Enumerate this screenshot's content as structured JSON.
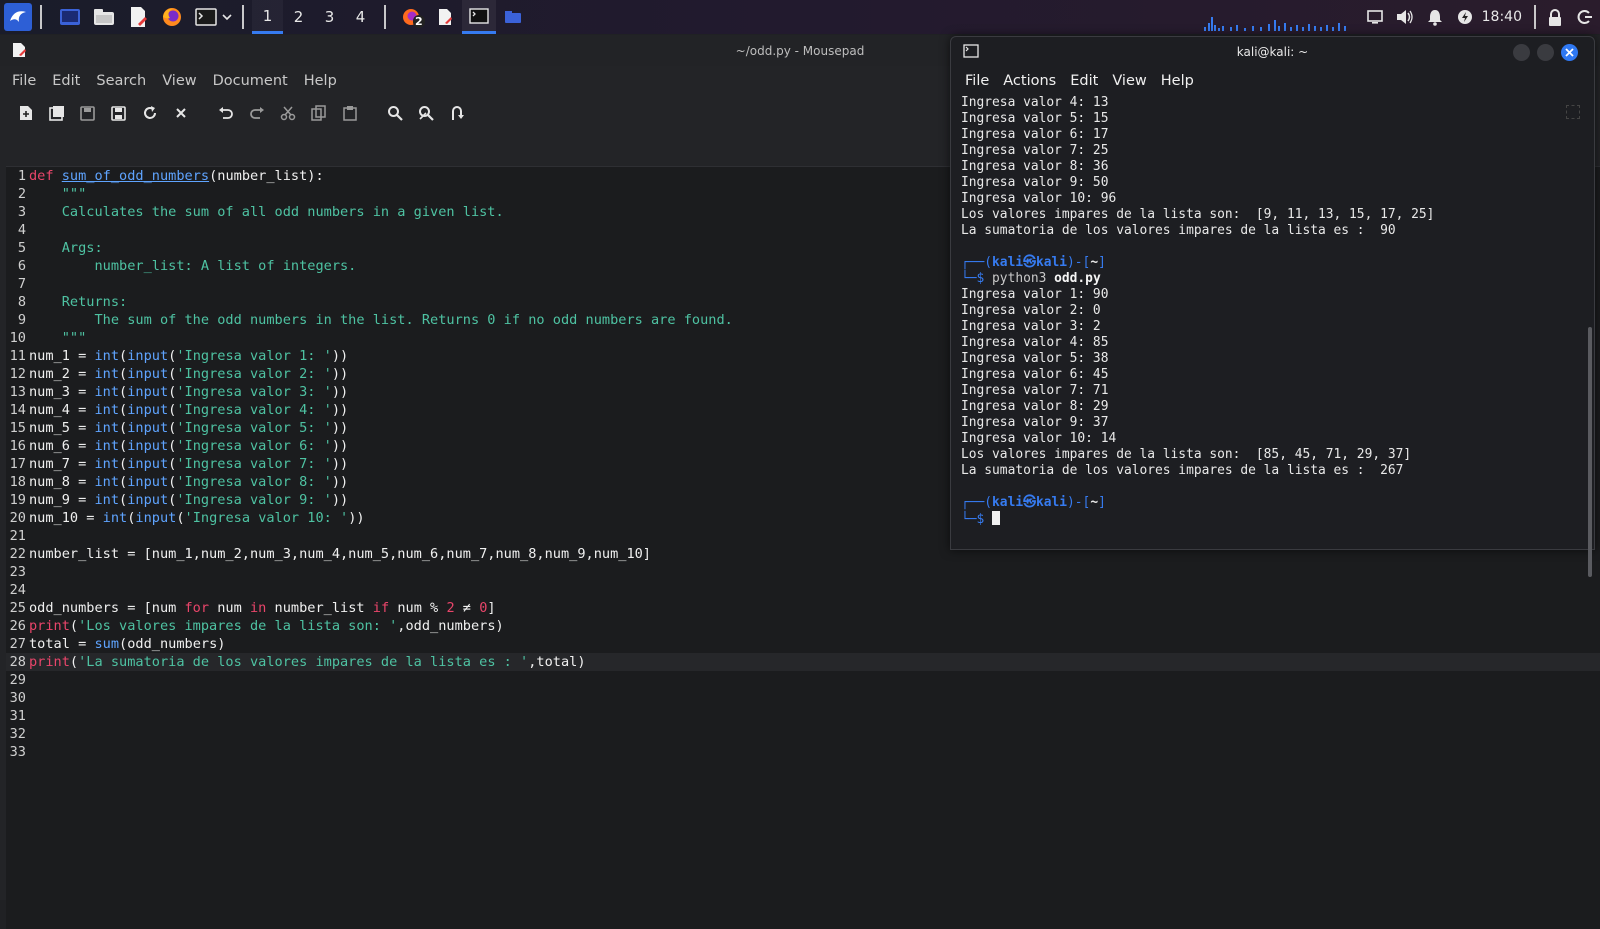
{
  "taskbar": {
    "workspaces": [
      "1",
      "2",
      "3",
      "4"
    ],
    "badge_count": "2",
    "clock": "18:40",
    "accent": "#367bf0"
  },
  "mousepad": {
    "title": "~/odd.py - Mousepad",
    "menu": [
      "File",
      "Edit",
      "Search",
      "View",
      "Document",
      "Help"
    ],
    "toolbar": [
      "new-document-icon",
      "new-window-icon",
      "save-icon",
      "save-as-icon",
      "reload-icon",
      "close-icon",
      "undo-icon",
      "redo-icon",
      "cut-icon",
      "copy-icon",
      "paste-icon",
      "find-icon",
      "find-replace-icon",
      "goto-icon"
    ],
    "current_line": 28,
    "code": [
      [
        [
          "kw",
          "def "
        ],
        [
          "fn",
          "sum_of_odd_numbers"
        ],
        [
          "df",
          "(number_list):"
        ]
      ],
      [
        [
          "cm",
          "    \"\"\""
        ]
      ],
      [
        [
          "cm",
          "    Calculates the sum of all odd numbers in a given list."
        ]
      ],
      [
        [
          "cm",
          ""
        ]
      ],
      [
        [
          "cm",
          "    Args:"
        ]
      ],
      [
        [
          "cm",
          "        number_list: A list of integers."
        ]
      ],
      [
        [
          "cm",
          ""
        ]
      ],
      [
        [
          "cm",
          "    Returns:"
        ]
      ],
      [
        [
          "cm",
          "        The sum of the odd numbers in the list. Returns 0 if no odd numbers are found."
        ]
      ],
      [
        [
          "cm",
          "    \"\"\""
        ]
      ],
      [
        [
          "df",
          "num_1 = "
        ],
        [
          "bi",
          "int"
        ],
        [
          "df",
          "("
        ],
        [
          "bi",
          "input"
        ],
        [
          "df",
          "("
        ],
        [
          "st",
          "'Ingresa valor 1: '"
        ],
        [
          "df",
          "))"
        ]
      ],
      [
        [
          "df",
          "num_2 = "
        ],
        [
          "bi",
          "int"
        ],
        [
          "df",
          "("
        ],
        [
          "bi",
          "input"
        ],
        [
          "df",
          "("
        ],
        [
          "st",
          "'Ingresa valor 2: '"
        ],
        [
          "df",
          "))"
        ]
      ],
      [
        [
          "df",
          "num_3 = "
        ],
        [
          "bi",
          "int"
        ],
        [
          "df",
          "("
        ],
        [
          "bi",
          "input"
        ],
        [
          "df",
          "("
        ],
        [
          "st",
          "'Ingresa valor 3: '"
        ],
        [
          "df",
          "))"
        ]
      ],
      [
        [
          "df",
          "num_4 = "
        ],
        [
          "bi",
          "int"
        ],
        [
          "df",
          "("
        ],
        [
          "bi",
          "input"
        ],
        [
          "df",
          "("
        ],
        [
          "st",
          "'Ingresa valor 4: '"
        ],
        [
          "df",
          "))"
        ]
      ],
      [
        [
          "df",
          "num_5 = "
        ],
        [
          "bi",
          "int"
        ],
        [
          "df",
          "("
        ],
        [
          "bi",
          "input"
        ],
        [
          "df",
          "("
        ],
        [
          "st",
          "'Ingresa valor 5: '"
        ],
        [
          "df",
          "))"
        ]
      ],
      [
        [
          "df",
          "num_6 = "
        ],
        [
          "bi",
          "int"
        ],
        [
          "df",
          "("
        ],
        [
          "bi",
          "input"
        ],
        [
          "df",
          "("
        ],
        [
          "st",
          "'Ingresa valor 6: '"
        ],
        [
          "df",
          "))"
        ]
      ],
      [
        [
          "df",
          "num_7 = "
        ],
        [
          "bi",
          "int"
        ],
        [
          "df",
          "("
        ],
        [
          "bi",
          "input"
        ],
        [
          "df",
          "("
        ],
        [
          "st",
          "'Ingresa valor 7: '"
        ],
        [
          "df",
          "))"
        ]
      ],
      [
        [
          "df",
          "num_8 = "
        ],
        [
          "bi",
          "int"
        ],
        [
          "df",
          "("
        ],
        [
          "bi",
          "input"
        ],
        [
          "df",
          "("
        ],
        [
          "st",
          "'Ingresa valor 8: '"
        ],
        [
          "df",
          "))"
        ]
      ],
      [
        [
          "df",
          "num_9 = "
        ],
        [
          "bi",
          "int"
        ],
        [
          "df",
          "("
        ],
        [
          "bi",
          "input"
        ],
        [
          "df",
          "("
        ],
        [
          "st",
          "'Ingresa valor 9: '"
        ],
        [
          "df",
          "))"
        ]
      ],
      [
        [
          "df",
          "num_10 = "
        ],
        [
          "bi",
          "int"
        ],
        [
          "df",
          "("
        ],
        [
          "bi",
          "input"
        ],
        [
          "df",
          "("
        ],
        [
          "st",
          "'Ingresa valor 10: '"
        ],
        [
          "df",
          "))"
        ]
      ],
      [],
      [
        [
          "df",
          "number_list = [num_1,num_2,num_3,num_4,num_5,num_6,num_7,num_8,num_9,num_10]"
        ]
      ],
      [],
      [],
      [
        [
          "df",
          "odd_numbers = [num "
        ],
        [
          "kw",
          "for"
        ],
        [
          "df",
          " num "
        ],
        [
          "kw",
          "in"
        ],
        [
          "df",
          " number_list "
        ],
        [
          "kw",
          "if"
        ],
        [
          "df",
          " num % "
        ],
        [
          "nm",
          "2"
        ],
        [
          "df",
          " ≠ "
        ],
        [
          "nm",
          "0"
        ],
        [
          "df",
          "]"
        ]
      ],
      [
        [
          "kw",
          "print"
        ],
        [
          "df",
          "("
        ],
        [
          "st",
          "'Los valores impares de la lista son: '"
        ],
        [
          "df",
          ",odd_numbers)"
        ]
      ],
      [
        [
          "df",
          "total = "
        ],
        [
          "bi",
          "sum"
        ],
        [
          "df",
          "(odd_numbers)"
        ]
      ],
      [
        [
          "kw",
          "print"
        ],
        [
          "df",
          "("
        ],
        [
          "st",
          "'La sumatoria de los valores impares de la lista es : '"
        ],
        [
          "df",
          ",total)"
        ]
      ],
      [],
      [],
      [],
      [],
      []
    ]
  },
  "terminal": {
    "title": "kali@kali: ~",
    "menu": [
      "File",
      "Actions",
      "Edit",
      "View",
      "Help"
    ],
    "output_top": [
      "Ingresa valor 4: 13",
      "Ingresa valor 5: 15",
      "Ingresa valor 6: 17",
      "Ingresa valor 7: 25",
      "Ingresa valor 8: 36",
      "Ingresa valor 9: 50",
      "Ingresa valor 10: 96",
      "Los valores impares de la lista son:  [9, 11, 13, 15, 17, 25]",
      "La sumatoria de los valores impares de la lista es :  90"
    ],
    "prompt_user": "kali",
    "prompt_host": "kali",
    "prompt_dir": "~",
    "command_name": "python3",
    "command_arg": "odd.py",
    "output_bottom": [
      "Ingresa valor 1: 90",
      "Ingresa valor 2: 0",
      "Ingresa valor 3: 2",
      "Ingresa valor 4: 85",
      "Ingresa valor 5: 38",
      "Ingresa valor 6: 45",
      "Ingresa valor 7: 71",
      "Ingresa valor 8: 29",
      "Ingresa valor 9: 37",
      "Ingresa valor 10: 14",
      "Los valores impares de la lista son:  [85, 45, 71, 29, 37]",
      "La sumatoria de los valores impares de la lista es :  267"
    ]
  }
}
